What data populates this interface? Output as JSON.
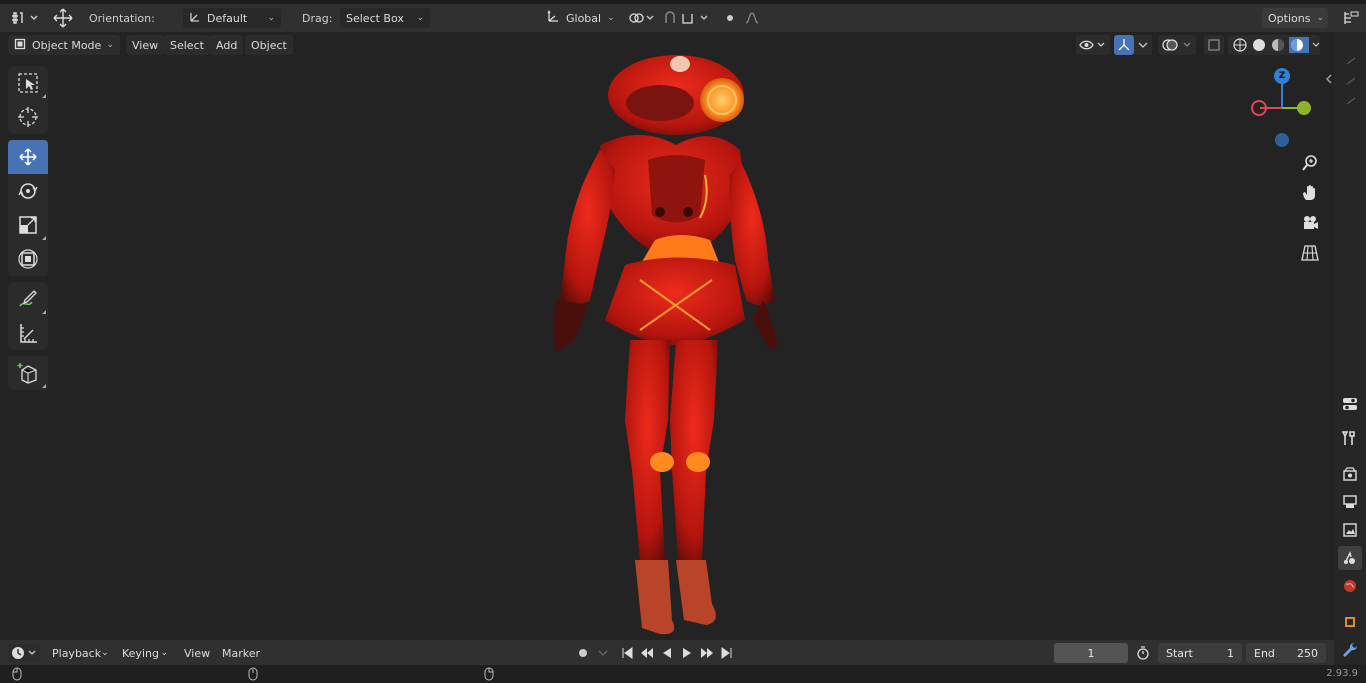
{
  "header": {
    "orientation_label": "Orientation:",
    "orientation_value": "Default",
    "drag_label": "Drag:",
    "drag_value": "Select Box",
    "transform_orientation": "Global",
    "options_label": "Options"
  },
  "viewport_header": {
    "mode": "Object Mode",
    "menus": [
      "View",
      "Select",
      "Add",
      "Object"
    ]
  },
  "toolbar": {
    "tools": [
      "select-box",
      "cursor",
      "move",
      "rotate",
      "scale",
      "transform",
      "annotate",
      "measure",
      "add-cube"
    ],
    "active": "move"
  },
  "gizmo": {
    "z_label": "Z",
    "accent_colors": {
      "x": "#e0455a",
      "y": "#8db52c",
      "z": "#2f80d6"
    }
  },
  "timeline": {
    "menus": [
      "Playback",
      "Keying",
      "View",
      "Marker"
    ],
    "current_frame": "1",
    "start_label": "Start",
    "start_value": "1",
    "end_label": "End",
    "end_value": "250"
  },
  "status": {
    "version": "2.93.9"
  },
  "colors": {
    "accent": "#4772b3",
    "model_red": "#d61a14",
    "model_orange": "#ff8a1e"
  }
}
